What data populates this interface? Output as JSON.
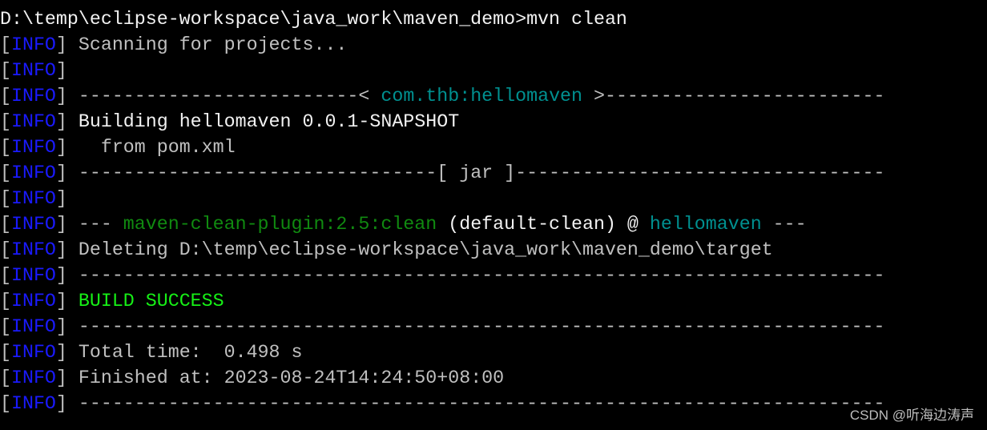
{
  "colors": {
    "bracket": "#c0c0c0",
    "info": "#1a1aff",
    "white": "#f2f2f2",
    "gray": "#c0c0c0",
    "teal": "#009090",
    "green": "#108a10",
    "bright_green": "#16f016"
  },
  "terminal": {
    "lines": [
      [
        {
          "t": "D:\\temp\\eclipse-workspace\\java_work\\maven_demo>mvn clean",
          "c": "white"
        }
      ],
      [
        {
          "t": "[INFO] ",
          "c": "info"
        },
        {
          "t": "Scanning for projects...",
          "c": "gray"
        }
      ],
      [
        {
          "t": "[INFO]",
          "c": "info"
        }
      ],
      [
        {
          "t": "[INFO] ",
          "c": "info"
        },
        {
          "t": "-------------------------< ",
          "c": "gray"
        },
        {
          "t": "com.thb:hellomaven",
          "c": "teal"
        },
        {
          "t": " >-------------------------",
          "c": "gray"
        }
      ],
      [
        {
          "t": "[INFO] ",
          "c": "info"
        },
        {
          "t": "Building hellomaven 0.0.1-SNAPSHOT",
          "c": "white"
        }
      ],
      [
        {
          "t": "[INFO] ",
          "c": "info"
        },
        {
          "t": "  from pom.xml",
          "c": "gray"
        }
      ],
      [
        {
          "t": "[INFO] ",
          "c": "info"
        },
        {
          "t": "--------------------------------[ jar ]---------------------------------",
          "c": "gray"
        }
      ],
      [
        {
          "t": "[INFO]",
          "c": "info"
        }
      ],
      [
        {
          "t": "[INFO] ",
          "c": "info"
        },
        {
          "t": "--- ",
          "c": "gray"
        },
        {
          "t": "maven-clean-plugin:2.5:clean",
          "c": "green"
        },
        {
          "t": " (default-clean) @ ",
          "c": "white"
        },
        {
          "t": "hellomaven",
          "c": "teal"
        },
        {
          "t": " ---",
          "c": "gray"
        }
      ],
      [
        {
          "t": "[INFO] ",
          "c": "info"
        },
        {
          "t": "Deleting D:\\temp\\eclipse-workspace\\java_work\\maven_demo\\target",
          "c": "gray"
        }
      ],
      [
        {
          "t": "[INFO] ",
          "c": "info"
        },
        {
          "t": "------------------------------------------------------------------------",
          "c": "gray"
        }
      ],
      [
        {
          "t": "[INFO] ",
          "c": "info"
        },
        {
          "t": "BUILD SUCCESS",
          "c": "bright_green"
        }
      ],
      [
        {
          "t": "[INFO] ",
          "c": "info"
        },
        {
          "t": "------------------------------------------------------------------------",
          "c": "gray"
        }
      ],
      [
        {
          "t": "[INFO] ",
          "c": "info"
        },
        {
          "t": "Total time:  0.498 s",
          "c": "gray"
        }
      ],
      [
        {
          "t": "[INFO] ",
          "c": "info"
        },
        {
          "t": "Finished at: 2023-08-24T14:24:50+08:00",
          "c": "gray"
        }
      ],
      [
        {
          "t": "[INFO] ",
          "c": "info"
        },
        {
          "t": "------------------------------------------------------------------------",
          "c": "gray"
        }
      ]
    ]
  },
  "watermark": "CSDN @听海边涛声"
}
